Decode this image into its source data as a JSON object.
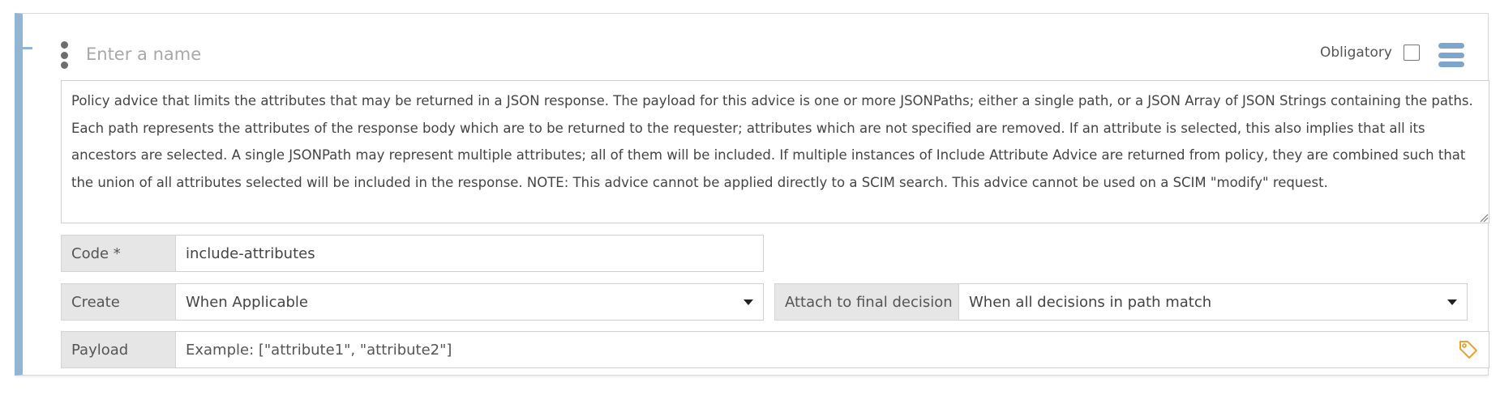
{
  "header": {
    "name_placeholder": "Enter a name",
    "obligatory_label": "Obligatory",
    "obligatory_checked": false
  },
  "description": "Policy advice that limits the attributes that may be returned in a JSON response. The payload for this advice is one or more JSONPaths; either a single path, or a JSON Array of JSON Strings containing the paths. Each path represents the attributes of the response body which are to be returned to the requester; attributes which are not specified are removed. If an attribute is selected, this also implies that all its ancestors are selected. A single JSONPath may represent multiple attributes; all of them will be included. If multiple instances of Include Attribute Advice are returned from policy, they are combined such that the union of all attributes selected will be included in the response. NOTE: This advice cannot be applied directly to a SCIM search. This advice cannot be used on a SCIM \"modify\" request.",
  "code": {
    "label": "Code *",
    "value": "include-attributes"
  },
  "create": {
    "label": "Create",
    "selected": "When Applicable"
  },
  "attach": {
    "label": "Attach to final decision",
    "selected": "When all decisions in path match"
  },
  "payload": {
    "label": "Payload",
    "placeholder": "Example: [\"attribute1\", \"attribute2\"]"
  },
  "icons": {
    "drag_handle": "vertical-dots-icon",
    "menu": "hamburger-menu-icon",
    "payload_tag": "tag-icon",
    "collapse": "collapse-minus-icon"
  },
  "colors": {
    "accent_border": "#93b5d4",
    "menu_icon": "#7ea6cc",
    "tag_icon": "#f0a030"
  }
}
